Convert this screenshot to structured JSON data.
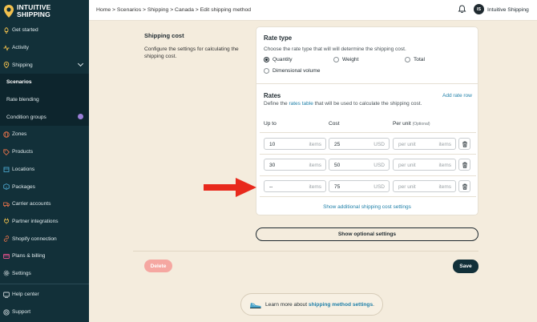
{
  "app": {
    "name": "INTUITIVE SHIPPING",
    "logo_line1": "INTUITIVE",
    "logo_line2": "SHIPPING"
  },
  "colors": {
    "sidebar": "#123039",
    "accent_link": "#1e7fa8",
    "delete": "#f5a7a1",
    "arrow": "#e8291c",
    "background": "#f4ecdd"
  },
  "sidebar": {
    "items": [
      {
        "label": "Get started",
        "icon": "rocket-icon"
      },
      {
        "label": "Activity",
        "icon": "activity-icon"
      },
      {
        "label": "Shipping",
        "icon": "pin-icon"
      },
      {
        "label": "Scenarios"
      },
      {
        "label": "Rate blending"
      },
      {
        "label": "Condition groups"
      },
      {
        "label": "Zones",
        "icon": "globe-icon"
      },
      {
        "label": "Products",
        "icon": "tag-icon"
      },
      {
        "label": "Locations",
        "icon": "building-icon"
      },
      {
        "label": "Packages",
        "icon": "box-icon"
      },
      {
        "label": "Carrier accounts",
        "icon": "truck-icon"
      },
      {
        "label": "Partner integrations",
        "icon": "plug-icon"
      },
      {
        "label": "Shopify connection",
        "icon": "link-icon"
      },
      {
        "label": "Plans & billing",
        "icon": "card-icon"
      },
      {
        "label": "Settings",
        "icon": "gear-icon"
      }
    ],
    "bottom": [
      {
        "label": "Help center",
        "icon": "help-icon"
      },
      {
        "label": "Support",
        "icon": "support-icon"
      }
    ]
  },
  "topbar": {
    "breadcrumb": "Home > Scenarios > Shipping > Canada > Edit shipping method",
    "avatar_initials": "IS",
    "user_name": "Intuitive Shipping"
  },
  "section": {
    "title": "Shipping cost",
    "description": "Configure the settings for calculating the shipping cost."
  },
  "rate_type": {
    "title": "Rate type",
    "description": "Choose the rate type that will will determine the shipping cost.",
    "options": [
      "Quantity",
      "Weight",
      "Total",
      "Dimensional volume"
    ],
    "selected": "Quantity"
  },
  "rates": {
    "title": "Rates",
    "add_label": "Add rate row",
    "desc_prefix": "Define the",
    "desc_link": "rates table",
    "desc_suffix": "that will be used to calculate the shipping cost.",
    "headers": {
      "up_to": "Up to",
      "cost": "Cost",
      "per_unit": "Per unit",
      "optional": "(Optional)"
    },
    "rows": [
      {
        "up_to": "10",
        "up_to_unit": "items",
        "cost": "25",
        "currency": "USD",
        "per_unit_placeholder": "per unit",
        "per_unit_unit": "items"
      },
      {
        "up_to": "30",
        "up_to_unit": "items",
        "cost": "50",
        "currency": "USD",
        "per_unit_placeholder": "per unit",
        "per_unit_unit": "items"
      },
      {
        "up_to": "--",
        "up_to_unit": "items",
        "cost": "75",
        "currency": "USD",
        "per_unit_placeholder": "per unit",
        "per_unit_unit": "items"
      }
    ],
    "show_additional": "Show additional shipping cost settings"
  },
  "buttons": {
    "optional_settings": "Show optional settings",
    "delete": "Delete",
    "save": "Save"
  },
  "learn": {
    "prefix": "Learn more about",
    "link": "shipping method settings",
    "suffix": "."
  }
}
